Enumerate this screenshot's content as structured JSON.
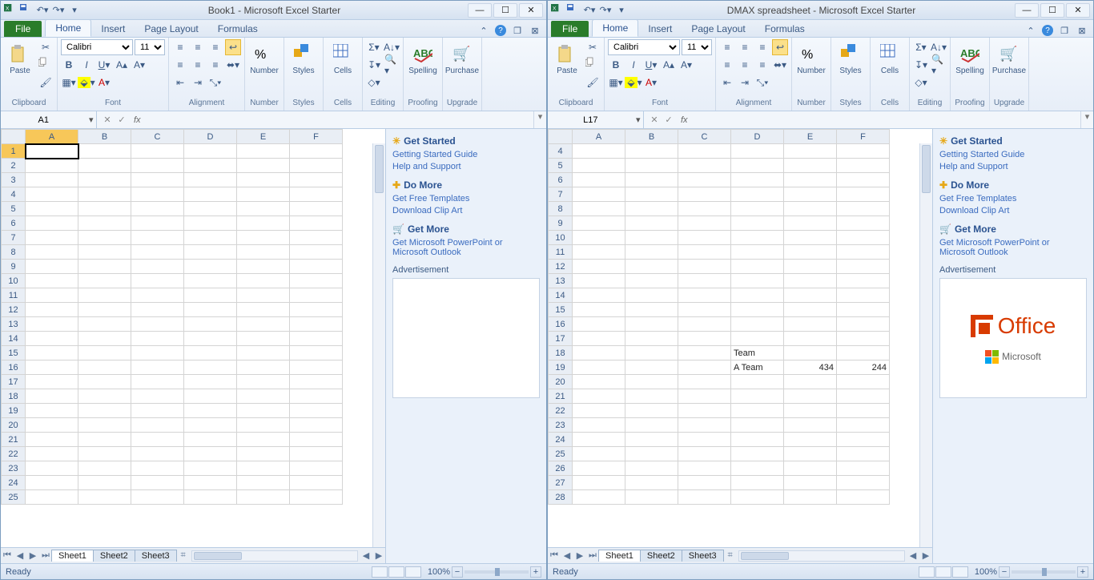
{
  "windows": [
    {
      "title": "Book1 - Microsoft Excel Starter",
      "nameBox": "A1",
      "formula": "",
      "activeCell": "A1",
      "rowStart": 1,
      "columns": [
        "A",
        "B",
        "C",
        "D",
        "E",
        "F"
      ],
      "cells": {},
      "adLogo": false
    },
    {
      "title": "DMAX spreadsheet - Microsoft Excel Starter",
      "nameBox": "L17",
      "formula": "",
      "activeCell": "",
      "rowStart": 4,
      "columns": [
        "A",
        "B",
        "C",
        "D",
        "E",
        "F"
      ],
      "cells": {
        "D18": "Team",
        "D19": "A Team",
        "E19": "434",
        "F19": "244"
      },
      "adLogo": true
    }
  ],
  "tabs": {
    "file": "File",
    "home": "Home",
    "insert": "Insert",
    "pageLayout": "Page Layout",
    "formulas": "Formulas"
  },
  "ribbon": {
    "clipboard": {
      "label": "Clipboard",
      "paste": "Paste"
    },
    "font": {
      "label": "Font",
      "name": "Calibri",
      "size": "11"
    },
    "alignment": {
      "label": "Alignment"
    },
    "number": {
      "label": "Number",
      "btn": "Number"
    },
    "styles": {
      "label": "Styles",
      "btn": "Styles"
    },
    "cells": {
      "label": "Cells",
      "btn": "Cells"
    },
    "editing": {
      "label": "Editing"
    },
    "proofing": {
      "label": "Proofing",
      "btn": "Spelling"
    },
    "upgrade": {
      "label": "Upgrade",
      "btn": "Purchase"
    }
  },
  "side": {
    "getStarted": {
      "head": "Get Started",
      "l1": "Getting Started Guide",
      "l2": "Help and Support"
    },
    "doMore": {
      "head": "Do More",
      "l1": "Get Free Templates",
      "l2": "Download Clip Art"
    },
    "getMore": {
      "head": "Get More",
      "l1": "Get Microsoft PowerPoint or Microsoft Outlook"
    },
    "ad": "Advertisement",
    "office": "Office",
    "microsoft": "Microsoft"
  },
  "sheets": {
    "s1": "Sheet1",
    "s2": "Sheet2",
    "s3": "Sheet3"
  },
  "status": {
    "ready": "Ready",
    "zoom": "100%"
  }
}
